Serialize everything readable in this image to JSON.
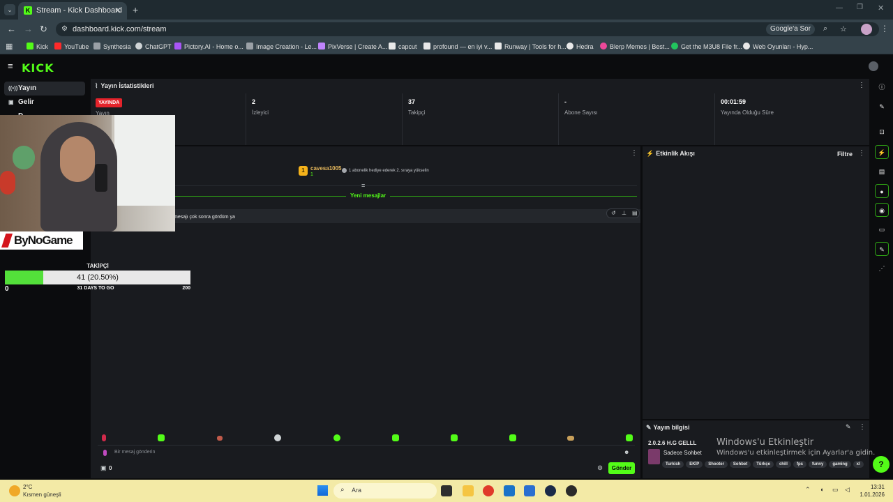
{
  "browser": {
    "tab_title": "Stream - Kick Dashboard",
    "url": "dashboard.kick.com/stream",
    "google_sor": "Google'a Sor",
    "bookmarks": [
      "Kick",
      "YouTube",
      "Synthesia",
      "ChatGPT",
      "Pictory.AI - Home o...",
      "Image Creation - Le...",
      "PixVerse | Create A...",
      "capcut",
      "profound — en iyi v...",
      "Runway | Tools for h...",
      "Hedra",
      "Blerp Memes | Best...",
      "Get the M3U8 File fr...",
      "Web Oyunları - Hyp..."
    ],
    "bookmark_colors": [
      "#53fc18",
      "#ff2a2a",
      "#9aa0a6",
      "#cfd4d6",
      "#a855f7",
      "#9aa0a6",
      "#c084fc",
      "#e8e8e8",
      "#e8e8e8",
      "#e8e8e8",
      "#e8e8e8",
      "#ec4899",
      "#22c55e",
      "#e8e8e8"
    ]
  },
  "kick": {
    "logo": "KICK",
    "sidebar": [
      "Yayın",
      "Gelir",
      "D..."
    ],
    "stats": {
      "header": "Yayın İstatistikleri",
      "live_badge": "YAYINDA",
      "live_sub": "Yayın",
      "viewers_value": "2",
      "viewers_label": "İzleyici",
      "followers_value": "37",
      "followers_label": "Takipçi",
      "subs_value": "-",
      "subs_label": "Abone Sayısı",
      "time_value": "00:01:59",
      "time_label": "Yayında Olduğu Süre"
    },
    "chat": {
      "pinned_user": "cavesa1005",
      "pinned_rank": "1",
      "pinned_hint": "1 abonelik hediye ederek 2. sıraya yükselin",
      "new_messages": "Yeni mesajlar",
      "message": "mesajı çok sonra gördüm ya",
      "input_placeholder": "Bir mesaj gönderin",
      "points": "0",
      "send": "Gönder"
    },
    "activity": {
      "title": "Etkinlik Akışı",
      "filter": "Filtre"
    },
    "stream_info": {
      "title": "Yayın bilgisi",
      "stream_title": "2.0.2.6 H.G GELLL",
      "category": "Sadece Sohbet",
      "tags": [
        "Turkish",
        "EKİP",
        "Shooter",
        "Sohbet",
        "Türkçe",
        "chill",
        "fps",
        "funny",
        "gaming",
        "xl"
      ]
    }
  },
  "overlay": {
    "brand": "ByNoGame",
    "goal_title": "TAKİPÇİ",
    "goal_text": "41 (20.50%)",
    "goal_fraction": 0.205,
    "goal_min": "0",
    "goal_days": "31 DAYS TO GO",
    "goal_max": "200"
  },
  "watermark": {
    "line1": "Windows'u Etkinleştir",
    "line2": "Windows'u etkinleştirmek için Ayarlar'a gidin."
  },
  "taskbar": {
    "weather_temp": "2°C",
    "weather_desc": "Kısmen güneşli",
    "search": "Ara",
    "time": "13:31",
    "date": "1.01.2026"
  }
}
